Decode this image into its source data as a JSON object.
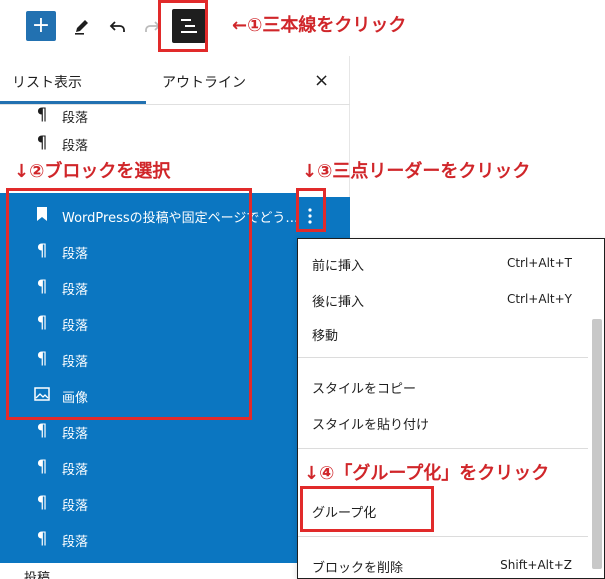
{
  "toolbar": {
    "add_label": "+",
    "edit_icon": "pencil-icon",
    "undo_icon": "undo-icon",
    "redo_icon": "redo-icon",
    "listview_icon": "list-view-icon"
  },
  "tabs": {
    "list": "リスト表示",
    "outline": "アウトライン",
    "close": "×"
  },
  "rows_before": [
    {
      "icon": "¶",
      "label": "段落"
    },
    {
      "icon": "¶",
      "label": "段落"
    }
  ],
  "selected_rows": [
    {
      "icon": "bookmark",
      "label": "WordPressの投稿や固定ページでどう…"
    },
    {
      "icon": "¶",
      "label": "段落"
    },
    {
      "icon": "¶",
      "label": "段落"
    },
    {
      "icon": "¶",
      "label": "段落"
    },
    {
      "icon": "¶",
      "label": "段落"
    },
    {
      "icon": "image",
      "label": "画像"
    },
    {
      "icon": "¶",
      "label": "段落"
    },
    {
      "icon": "¶",
      "label": "段落"
    },
    {
      "icon": "¶",
      "label": "段落"
    },
    {
      "icon": "¶",
      "label": "段落"
    }
  ],
  "bottom_partial": "投稿",
  "menu": {
    "insert_before": "前に挿入",
    "insert_before_shortcut": "Ctrl+Alt+T",
    "insert_after": "後に挿入",
    "insert_after_shortcut": "Ctrl+Alt+Y",
    "move": "移動",
    "copy_styles": "スタイルをコピー",
    "paste_styles": "スタイルを貼り付け",
    "group": "グループ化",
    "delete": "ブロックを削除",
    "delete_shortcut": "Shift+Alt+Z"
  },
  "annotations": {
    "step1": "←①三本線をクリック",
    "step2": "↓②ブロックを選択",
    "step3": "↓③三点リーダーをクリック",
    "step4": "↓④「グループ化」をクリック"
  },
  "colors": {
    "accent": "#0b76c1",
    "annotation": "#d0262a"
  }
}
